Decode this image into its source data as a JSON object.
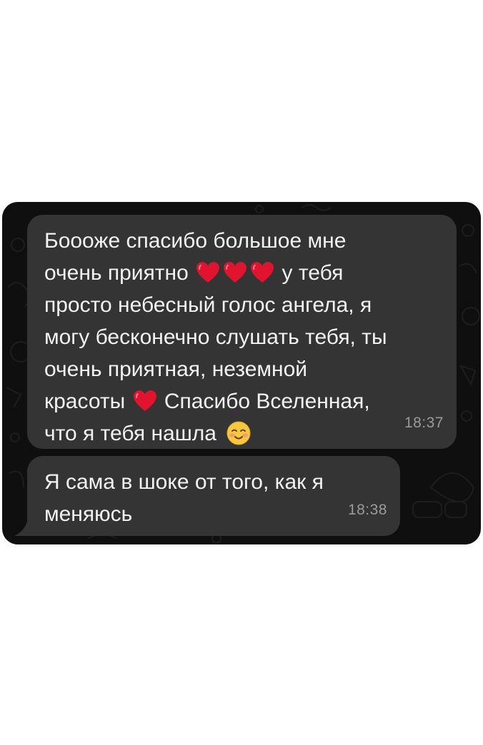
{
  "chat": {
    "messages": [
      {
        "lines": [
          "Боооже спасибо большое мне",
          "очень приятно",
          "у тебя",
          "просто небесный голос ангела, я",
          "могу бесконечно слушать тебя, ты",
          "очень приятная, неземной",
          "красоты",
          "Спасибо Вселенная,",
          "что я тебя нашла"
        ],
        "time": "18:37"
      },
      {
        "lines": [
          "Я сама в шоке от того, как я",
          "меняюсь"
        ],
        "time": "18:38"
      }
    ]
  },
  "icons": {
    "heart": "heart-emoji",
    "smile": "smiling-face-emoji"
  },
  "colors": {
    "background": "#0f0f0f",
    "bubble": "#343434",
    "text": "#f2f2f2",
    "timestamp": "#9a9a9a",
    "heart": "#e0142e"
  }
}
